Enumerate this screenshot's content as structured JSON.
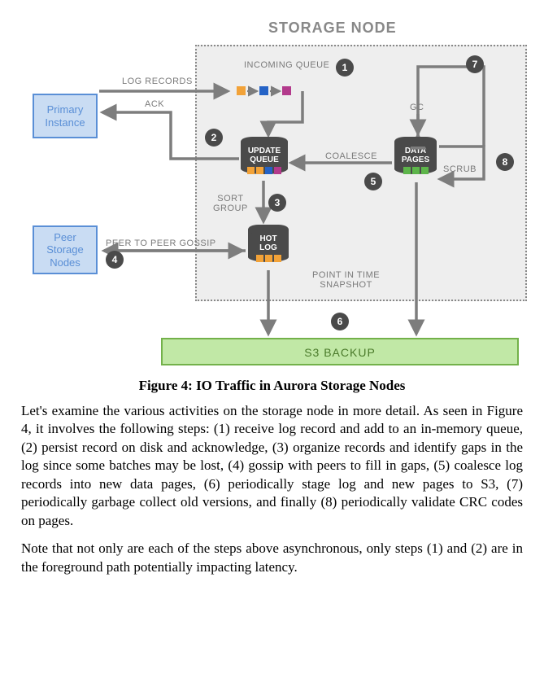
{
  "diagram": {
    "title": "STORAGE NODE",
    "boxes": {
      "primary": {
        "line1": "Primary",
        "line2": "Instance"
      },
      "peer": {
        "line1": "Peer",
        "line2": "Storage",
        "line3": "Nodes"
      },
      "s3": "S3 BACKUP"
    },
    "cylinders": {
      "update_queue": {
        "label1": "UPDATE",
        "label2": "QUEUE"
      },
      "hot_log": {
        "label1": "HOT",
        "label2": "LOG"
      },
      "data_pages": {
        "label1": "DATA",
        "label2": "PAGES"
      }
    },
    "labels": {
      "log_records": "LOG RECORDS",
      "ack": "ACK",
      "incoming_queue": "INCOMING QUEUE",
      "sort_group": "SORT\nGROUP",
      "peer_gossip": "PEER TO PEER GOSSIP",
      "coalesce": "COALESCE",
      "gc": "GC",
      "scrub": "SCRUB",
      "snapshot": "POINT IN TIME\nSNAPSHOT"
    },
    "steps": {
      "1": "1",
      "2": "2",
      "3": "3",
      "4": "4",
      "5": "5",
      "6": "6",
      "7": "7",
      "8": "8"
    }
  },
  "caption": "Figure 4: IO Traffic in Aurora Storage Nodes",
  "paragraph1": "Let's examine the various activities on the storage node in more detail. As seen in Figure 4, it involves the following steps: (1) receive log record and add to an in-memory queue, (2) persist record on disk and acknowledge, (3) organize records and identify gaps in the log since some batches may be lost, (4) gossip with peers to fill in gaps, (5) coalesce log records into new data pages, (6) periodically stage log and new pages to S3, (7) periodically garbage collect old versions, and finally (8) periodically validate CRC codes on pages.",
  "paragraph2": "Note that not only are each of the steps above asynchronous, only steps (1) and (2) are in the foreground path potentially impacting latency."
}
